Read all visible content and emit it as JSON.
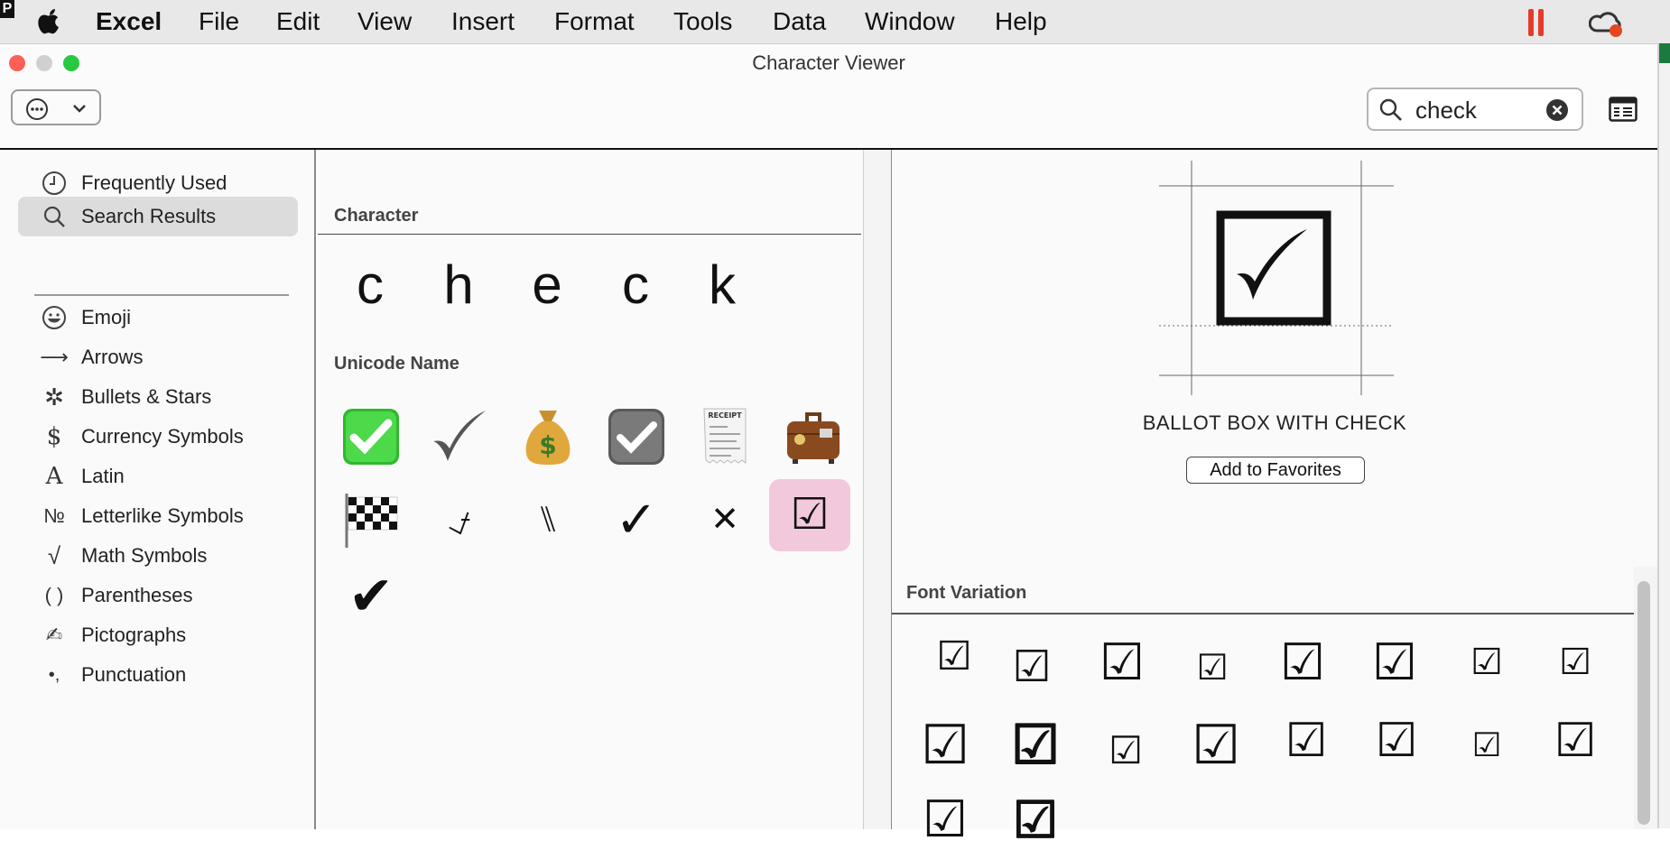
{
  "menubar": {
    "app_name": "Excel",
    "items": [
      "File",
      "Edit",
      "View",
      "Insert",
      "Format",
      "Tools",
      "Data",
      "Window",
      "Help"
    ],
    "corner_glyph": "P"
  },
  "window": {
    "title": "Character Viewer"
  },
  "toolbar": {
    "search_value": "check"
  },
  "sidebar": {
    "items": [
      {
        "label": "Frequently Used",
        "icon": "clock-icon"
      },
      {
        "label": "Search Results",
        "icon": "magnifier-icon",
        "selected": true
      },
      {
        "label": "Emoji",
        "icon": "smiley-icon"
      },
      {
        "label": "Arrows",
        "icon": "arrow-icon",
        "glyph": "⟶"
      },
      {
        "label": "Bullets & Stars",
        "icon": "bullet-star-icon",
        "glyph": "✲"
      },
      {
        "label": "Currency Symbols",
        "icon": "dollar-icon",
        "glyph": "$"
      },
      {
        "label": "Latin",
        "icon": "latin-a-icon",
        "glyph": "A"
      },
      {
        "label": "Letterlike Symbols",
        "icon": "numero-icon",
        "glyph": "№"
      },
      {
        "label": "Math Symbols",
        "icon": "square-root-icon",
        "glyph": "√"
      },
      {
        "label": "Parentheses",
        "icon": "parentheses-icon",
        "glyph": "( )"
      },
      {
        "label": "Pictographs",
        "icon": "writing-hand-icon",
        "glyph": "✍"
      },
      {
        "label": "Punctuation",
        "icon": "punctuation-icon",
        "glyph": "•,"
      }
    ]
  },
  "middle": {
    "character_title": "Character",
    "letters": [
      "c",
      "h",
      "e",
      "c",
      "k"
    ],
    "unicode_title": "Unicode Name",
    "glyphs": [
      {
        "glyph": "✅",
        "name": "white-heavy-check-mark"
      },
      {
        "glyph": "✔",
        "name": "heavy-check-mark-gray"
      },
      {
        "glyph": "💰",
        "name": "money-bag"
      },
      {
        "glyph": "☑",
        "name": "checkbox-gray"
      },
      {
        "glyph": "🧾",
        "name": "receipt"
      },
      {
        "glyph": "🧳",
        "name": "luggage"
      },
      {
        "glyph": "🏁",
        "name": "chequered-flag"
      },
      {
        "glyph": "⍻",
        "name": "not-check-mark"
      },
      {
        "glyph": "⑊",
        "name": "ocr-double-backslash"
      },
      {
        "glyph": "✓",
        "name": "check-mark"
      },
      {
        "glyph": "✕",
        "name": "multiplication-x"
      },
      {
        "glyph": "☑",
        "name": "ballot-box-with-check",
        "selected": true
      },
      {
        "glyph": "✔",
        "name": "heavy-check-mark"
      }
    ]
  },
  "detail": {
    "preview_glyph": "☑",
    "character_name": "BALLOT BOX WITH CHECK",
    "favorites_label": "Add to Favorites",
    "font_variation_title": "Font Variation",
    "variations": [
      "☑",
      "☑",
      "☑",
      "☑",
      "☑",
      "☑",
      "☑",
      "☑",
      "☑",
      "☑",
      "☑",
      "☑",
      "☑",
      "☑",
      "☑",
      "☑",
      "☑",
      "☑"
    ]
  },
  "colors": {
    "menubar_bg": "#e8e8e8",
    "close": "#fe5f57",
    "minimize": "#d0d0d0",
    "zoom": "#28c840",
    "selection_pink": "#f2c8dc",
    "sidebar_selection": "#dcdcdc"
  }
}
